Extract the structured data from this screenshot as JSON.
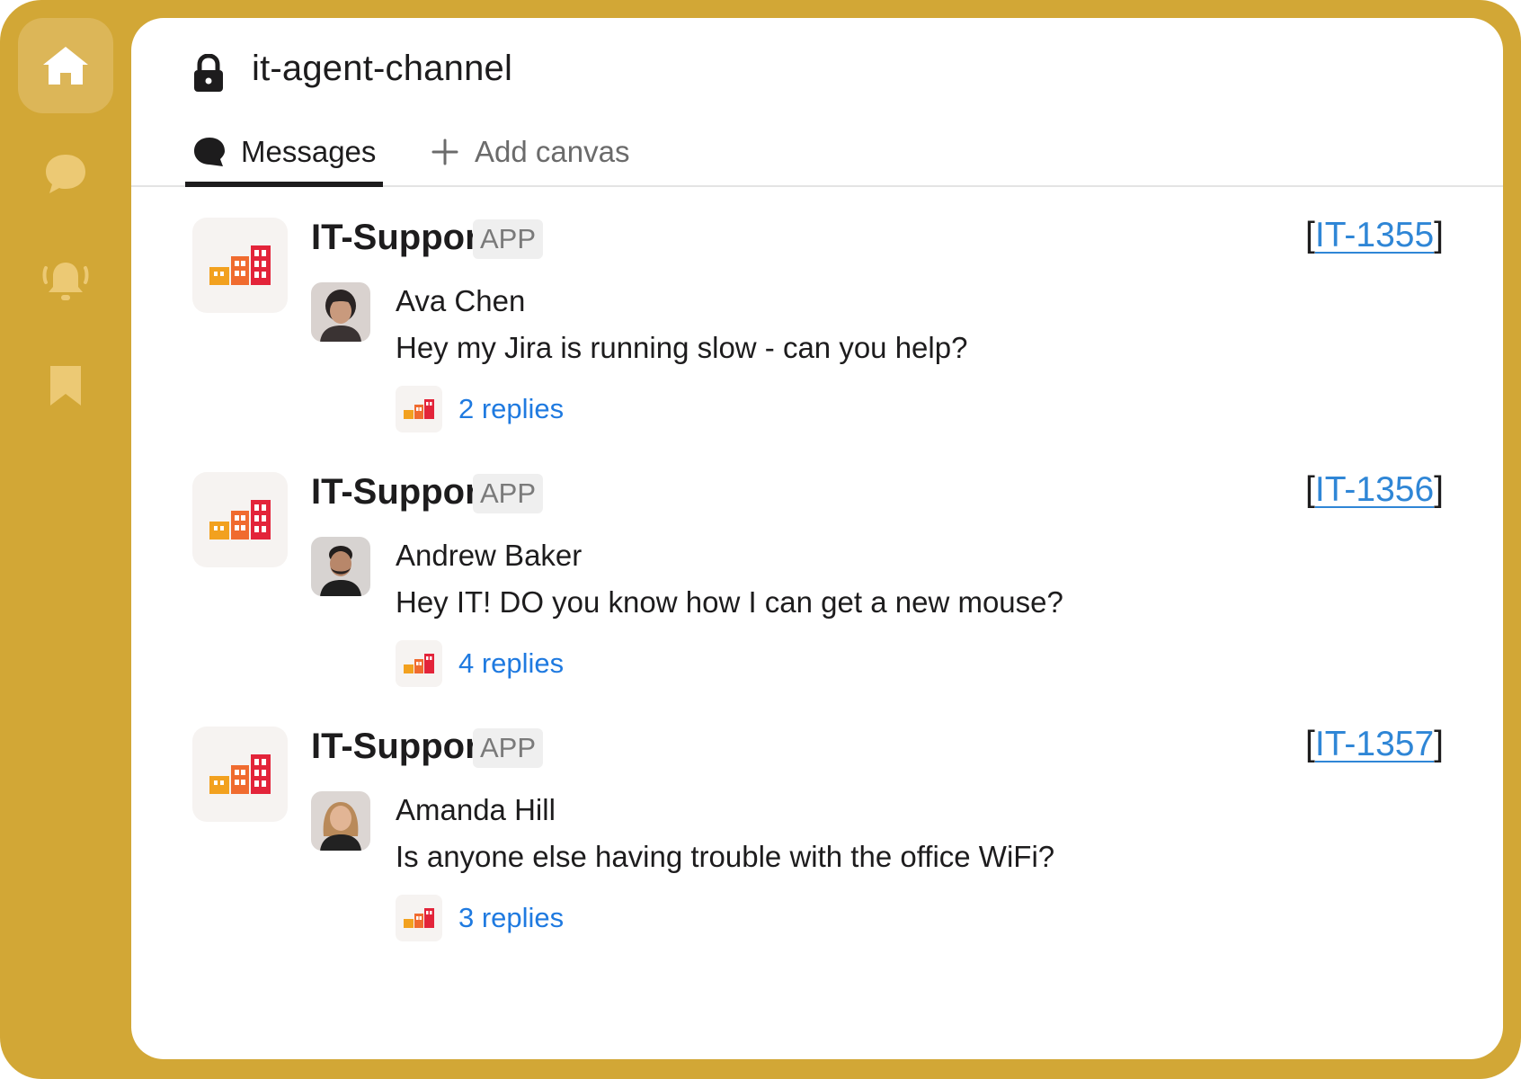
{
  "sidebar": {
    "icons": [
      "home-icon",
      "chat-bubble-icon",
      "bell-icon",
      "bookmark-icon"
    ]
  },
  "header": {
    "channel_name": "it-agent-channel",
    "tabs": [
      {
        "label": "Messages",
        "active": true
      },
      {
        "label": "Add canvas",
        "active": false
      }
    ]
  },
  "messages": [
    {
      "app_name": "IT-Support",
      "badge": "APP",
      "ticket": "IT-1355",
      "user": "Ava Chen",
      "text": "Hey my Jira is running slow - can you help?",
      "replies": "2 replies"
    },
    {
      "app_name": "IT-Support",
      "badge": "APP",
      "ticket": "IT-1356",
      "user": "Andrew Baker",
      "text": "Hey IT! DO you know how I can get a new mouse?",
      "replies": "4 replies"
    },
    {
      "app_name": "IT-Support",
      "badge": "APP",
      "ticket": "IT-1357",
      "user": "Amanda Hill",
      "text": "Is anyone else having trouble with the office WiFi?",
      "replies": "3 replies"
    }
  ],
  "colors": {
    "frame": "#d2a736",
    "link": "#1f7ae0",
    "ticket_link": "#2f86d6",
    "text": "#1d1c1d"
  }
}
